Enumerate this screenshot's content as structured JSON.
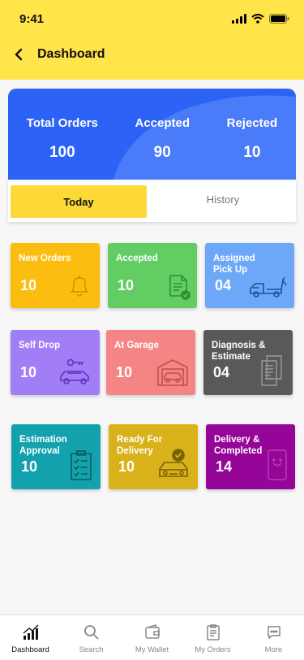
{
  "status": {
    "time": "9:41"
  },
  "header": {
    "title": "Dashboard"
  },
  "summary": {
    "total_label": "Total Orders",
    "total_value": "100",
    "accepted_label": "Accepted",
    "accepted_value": "90",
    "rejected_label": "Rejected",
    "rejected_value": "10"
  },
  "tabs": {
    "today": "Today",
    "history": "History"
  },
  "cards": [
    {
      "title": "New Orders",
      "value": "10",
      "color": "#fcbd11",
      "icon": "bell-icon"
    },
    {
      "title": "Accepted",
      "value": "10",
      "color": "#62cd63",
      "icon": "document-check-icon"
    },
    {
      "title": "Assigned\nPick Up",
      "value": "04",
      "color": "#6da8f8",
      "icon": "tow-truck-icon"
    },
    {
      "title": "Self Drop",
      "value": "10",
      "color": "#a17ef5",
      "icon": "car-key-icon"
    },
    {
      "title": "At Garage",
      "value": "10",
      "color": "#f58585",
      "icon": "garage-icon"
    },
    {
      "title": "Diagnosis &\nEstimate",
      "value": "04",
      "color": "#595959",
      "icon": "documents-icon"
    },
    {
      "title": "Estimation\nApproval",
      "value": "10",
      "color": "#13a2ad",
      "icon": "clipboard-checklist-icon"
    },
    {
      "title": "Ready For\nDelivery",
      "value": "10",
      "color": "#d9b11a",
      "icon": "car-check-icon"
    },
    {
      "title": "Delivery &\nCompleted",
      "value": "14",
      "color": "#950598",
      "icon": "phone-icon"
    }
  ],
  "bottom_nav": [
    {
      "label": "Dashboard",
      "icon": "chart-icon",
      "active": true
    },
    {
      "label": "Search",
      "icon": "search-icon",
      "active": false
    },
    {
      "label": "My Wallet",
      "icon": "wallet-icon",
      "active": false
    },
    {
      "label": "My Orders",
      "icon": "orders-icon",
      "active": false
    },
    {
      "label": "More",
      "icon": "chat-icon",
      "active": false
    }
  ]
}
